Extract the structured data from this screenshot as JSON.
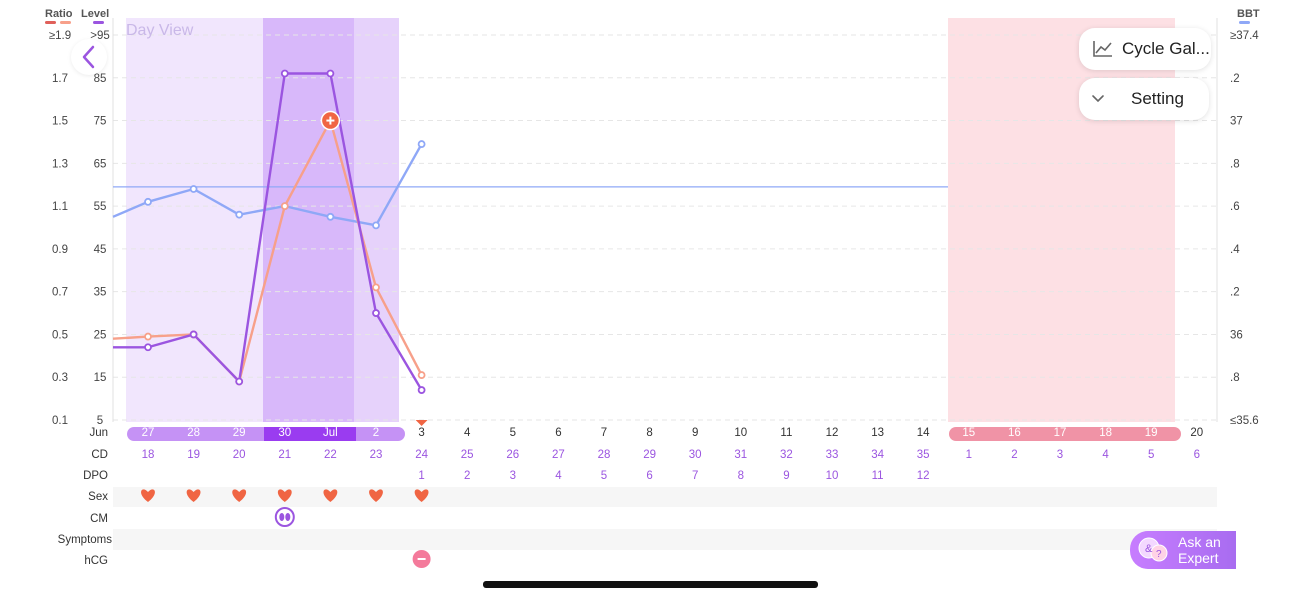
{
  "legend": {
    "ratio_label": "Ratio",
    "level_label": "Level",
    "bbt_label": "BBT",
    "ratio_colors": [
      "#e0605a",
      "#f7a08a"
    ],
    "level_color": "#9b55e0",
    "bbt_color": "#8fa8f7"
  },
  "left_axis": {
    "ratio_ticks": [
      "≥1.9",
      "1.7",
      "1.5",
      "1.3",
      "1.1",
      "0.9",
      "0.7",
      "0.5",
      "0.3",
      "0.1"
    ],
    "level_ticks": [
      ">95",
      "85",
      "75",
      "65",
      "55",
      "45",
      "35",
      "25",
      "15",
      "5"
    ]
  },
  "right_axis": {
    "bbt_ticks": [
      "≥37.4",
      ".2",
      "37",
      ".8",
      ".6",
      ".4",
      ".2",
      "36",
      ".8",
      "≤35.6"
    ]
  },
  "day_view_label": "Day View",
  "buttons": {
    "cycle_gallery": "Cycle Gal...",
    "setting": "Setting",
    "ask_expert_line1": "Ask an",
    "ask_expert_line2": "Expert"
  },
  "rows": {
    "month": "Jun",
    "cd": "CD",
    "dpo": "DPO",
    "sex": "Sex",
    "cm": "CM",
    "symptoms": "Symptoms",
    "hcg": "hCG"
  },
  "dates": [
    "27",
    "28",
    "29",
    "30",
    "Jul",
    "2",
    "3",
    "4",
    "5",
    "6",
    "7",
    "8",
    "9",
    "10",
    "11",
    "12",
    "13",
    "14",
    "15",
    "16",
    "17",
    "18",
    "19",
    "20"
  ],
  "cd_values": [
    "18",
    "19",
    "20",
    "21",
    "22",
    "23",
    "24",
    "25",
    "26",
    "27",
    "28",
    "29",
    "30",
    "31",
    "32",
    "33",
    "34",
    "35",
    "1",
    "2",
    "3",
    "4",
    "5",
    "6"
  ],
  "dpo_values": [
    "",
    "",
    "",
    "",
    "",
    "",
    "1",
    "2",
    "3",
    "4",
    "5",
    "6",
    "7",
    "8",
    "9",
    "10",
    "11",
    "12",
    "",
    "",
    "",
    "",
    "",
    ""
  ],
  "sex_days": [
    0,
    1,
    2,
    3,
    4,
    5,
    6
  ],
  "cm_days": [
    3
  ],
  "hcg_days": [
    6
  ],
  "chart_data": {
    "type": "line",
    "x": [
      "27",
      "28",
      "29",
      "30",
      "Jul",
      "2",
      "3"
    ],
    "series": [
      {
        "name": "Ratio",
        "color": "#f7a08a",
        "values": [
          0.49,
          0.5,
          0.28,
          1.1,
          1.5,
          0.72,
          0.31
        ],
        "leading_value": 0.48
      },
      {
        "name": "Level",
        "color": "#9b55e0",
        "values": [
          22,
          25,
          14,
          86,
          86,
          30,
          12
        ],
        "leading_value": 22
      },
      {
        "name": "BBT",
        "color": "#8fa8f7",
        "values": [
          36.62,
          36.68,
          36.56,
          36.6,
          36.55,
          36.51,
          36.89
        ],
        "leading_value": 36.55
      }
    ],
    "ratio_range": [
      0.1,
      1.9
    ],
    "level_range": [
      5,
      95
    ],
    "bbt_range": [
      35.6,
      37.4
    ],
    "coverline_bbt": 36.69,
    "peak_marker_day": "Jul",
    "today_marker_day": "3",
    "grid": true
  }
}
